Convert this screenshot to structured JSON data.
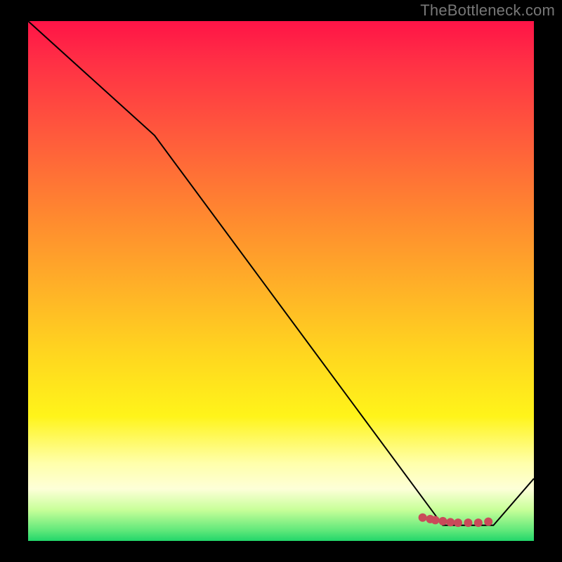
{
  "attribution": "TheBottleneck.com",
  "chart_data": {
    "type": "line",
    "title": "",
    "xlabel": "",
    "ylabel": "",
    "xlim": [
      0,
      100
    ],
    "ylim": [
      0,
      100
    ],
    "grid": false,
    "series": [
      {
        "name": "curve",
        "color": "#000000",
        "values": [
          {
            "x": 0,
            "y": 100
          },
          {
            "x": 25,
            "y": 78
          },
          {
            "x": 82,
            "y": 3
          },
          {
            "x": 92,
            "y": 3
          },
          {
            "x": 100,
            "y": 12
          }
        ]
      }
    ],
    "markers": [
      {
        "x": 78,
        "y": 4.5,
        "color": "#c94a5a"
      },
      {
        "x": 79.5,
        "y": 4.2,
        "color": "#c94a5a"
      },
      {
        "x": 80.5,
        "y": 4.0,
        "color": "#c94a5a"
      },
      {
        "x": 82,
        "y": 3.8,
        "color": "#c94a5a"
      },
      {
        "x": 83.5,
        "y": 3.6,
        "color": "#c94a5a"
      },
      {
        "x": 85,
        "y": 3.5,
        "color": "#c94a5a"
      },
      {
        "x": 87,
        "y": 3.5,
        "color": "#c94a5a"
      },
      {
        "x": 89,
        "y": 3.5,
        "color": "#c94a5a"
      },
      {
        "x": 91,
        "y": 3.7,
        "color": "#c94a5a"
      }
    ]
  }
}
